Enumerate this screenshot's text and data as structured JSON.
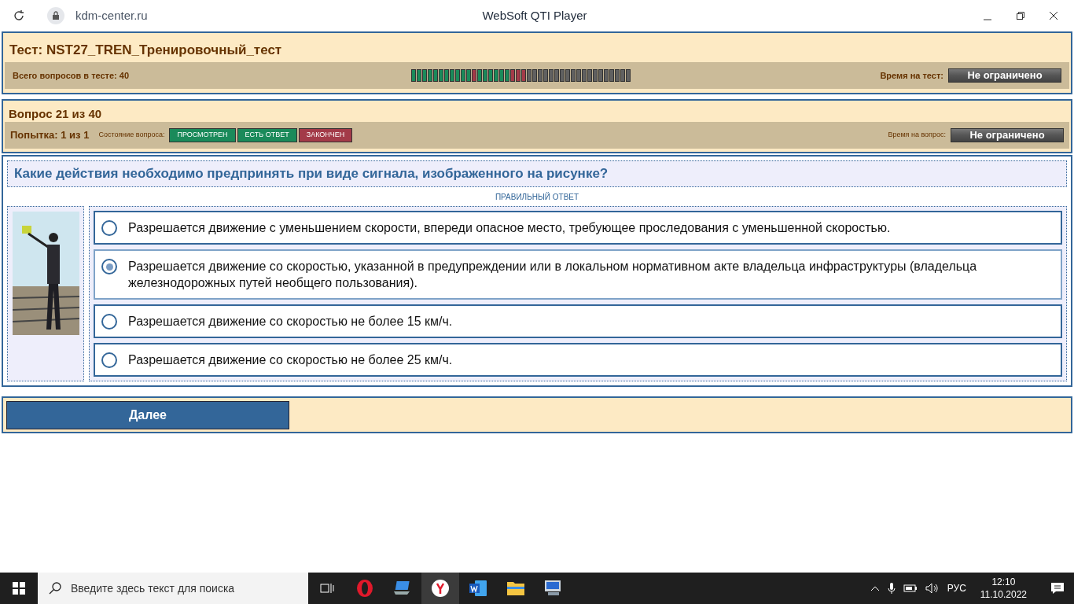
{
  "browser": {
    "address": "kdm-center.ru",
    "title": "WebSoft QTI Player"
  },
  "test": {
    "title": "Тест: NST27_TREN_Тренировочный_тест",
    "total_label": "Всего вопросов в тесте: 40",
    "time_label": "Время на тест:",
    "time_value": "Не ограничено",
    "progress": [
      {
        "color": "#1a8a5a"
      },
      {
        "color": "#1a8a5a"
      },
      {
        "color": "#1a8a5a"
      },
      {
        "color": "#1a8a5a"
      },
      {
        "color": "#1a8a5a"
      },
      {
        "color": "#1a8a5a"
      },
      {
        "color": "#1a8a5a"
      },
      {
        "color": "#1a8a5a"
      },
      {
        "color": "#1a8a5a"
      },
      {
        "color": "#1a8a5a"
      },
      {
        "color": "#1a8a5a"
      },
      {
        "color": "#a33a48"
      },
      {
        "color": "#1a8a5a"
      },
      {
        "color": "#1a8a5a"
      },
      {
        "color": "#1a8a5a"
      },
      {
        "color": "#1a8a5a"
      },
      {
        "color": "#1a8a5a"
      },
      {
        "color": "#1a8a5a"
      },
      {
        "color": "#a33a48"
      },
      {
        "color": "#a33a48"
      },
      {
        "color": "#a33a48"
      },
      {
        "color": "#606060"
      },
      {
        "color": "#606060"
      },
      {
        "color": "#606060"
      },
      {
        "color": "#606060"
      },
      {
        "color": "#606060"
      },
      {
        "color": "#606060"
      },
      {
        "color": "#606060"
      },
      {
        "color": "#606060"
      },
      {
        "color": "#606060"
      },
      {
        "color": "#606060"
      },
      {
        "color": "#606060"
      },
      {
        "color": "#606060"
      },
      {
        "color": "#606060"
      },
      {
        "color": "#606060"
      },
      {
        "color": "#606060"
      },
      {
        "color": "#606060"
      },
      {
        "color": "#606060"
      },
      {
        "color": "#606060"
      },
      {
        "color": "#606060"
      }
    ]
  },
  "question": {
    "number": "Вопрос 21 из 40",
    "attempt": "Попытка: 1 из 1",
    "state_label": "Состояние вопроса:",
    "states": [
      {
        "label": "ПРОСМОТРЕН",
        "color": "#1a8a5a"
      },
      {
        "label": "ЕСТЬ ОТВЕТ",
        "color": "#1a8a5a"
      },
      {
        "label": "ЗАКОНЧЕН",
        "color": "#a33a48"
      }
    ],
    "time_label": "Время на вопрос:",
    "time_value": "Не ограничено",
    "text": "Какие действия необходимо предпринять при виде сигнала, изображенного на рисунке?",
    "hint": "ПРАВИЛЬНЫЙ ОТВЕТ",
    "answers": [
      {
        "text": "Разрешается движение с уменьшением скорости, впереди опасное место, требующее проследования с уменьшенной скоростью.",
        "selected": false
      },
      {
        "text": "Разрешается движение со скоростью, указанной в предупреждении или в локальном нормативном акте владельца инфраструктуры (владельца железнодорожных путей необщего пользования).",
        "selected": true
      },
      {
        "text": "Разрешается движение со скоростью не более 15 км/ч.",
        "selected": false
      },
      {
        "text": "Разрешается движение со скоростью не более 25 км/ч.",
        "selected": false
      }
    ]
  },
  "next_button": "Далее",
  "taskbar": {
    "search_placeholder": "Введите здесь текст для поиска",
    "language": "РУС",
    "time": "12:10",
    "date": "11.10.2022"
  }
}
